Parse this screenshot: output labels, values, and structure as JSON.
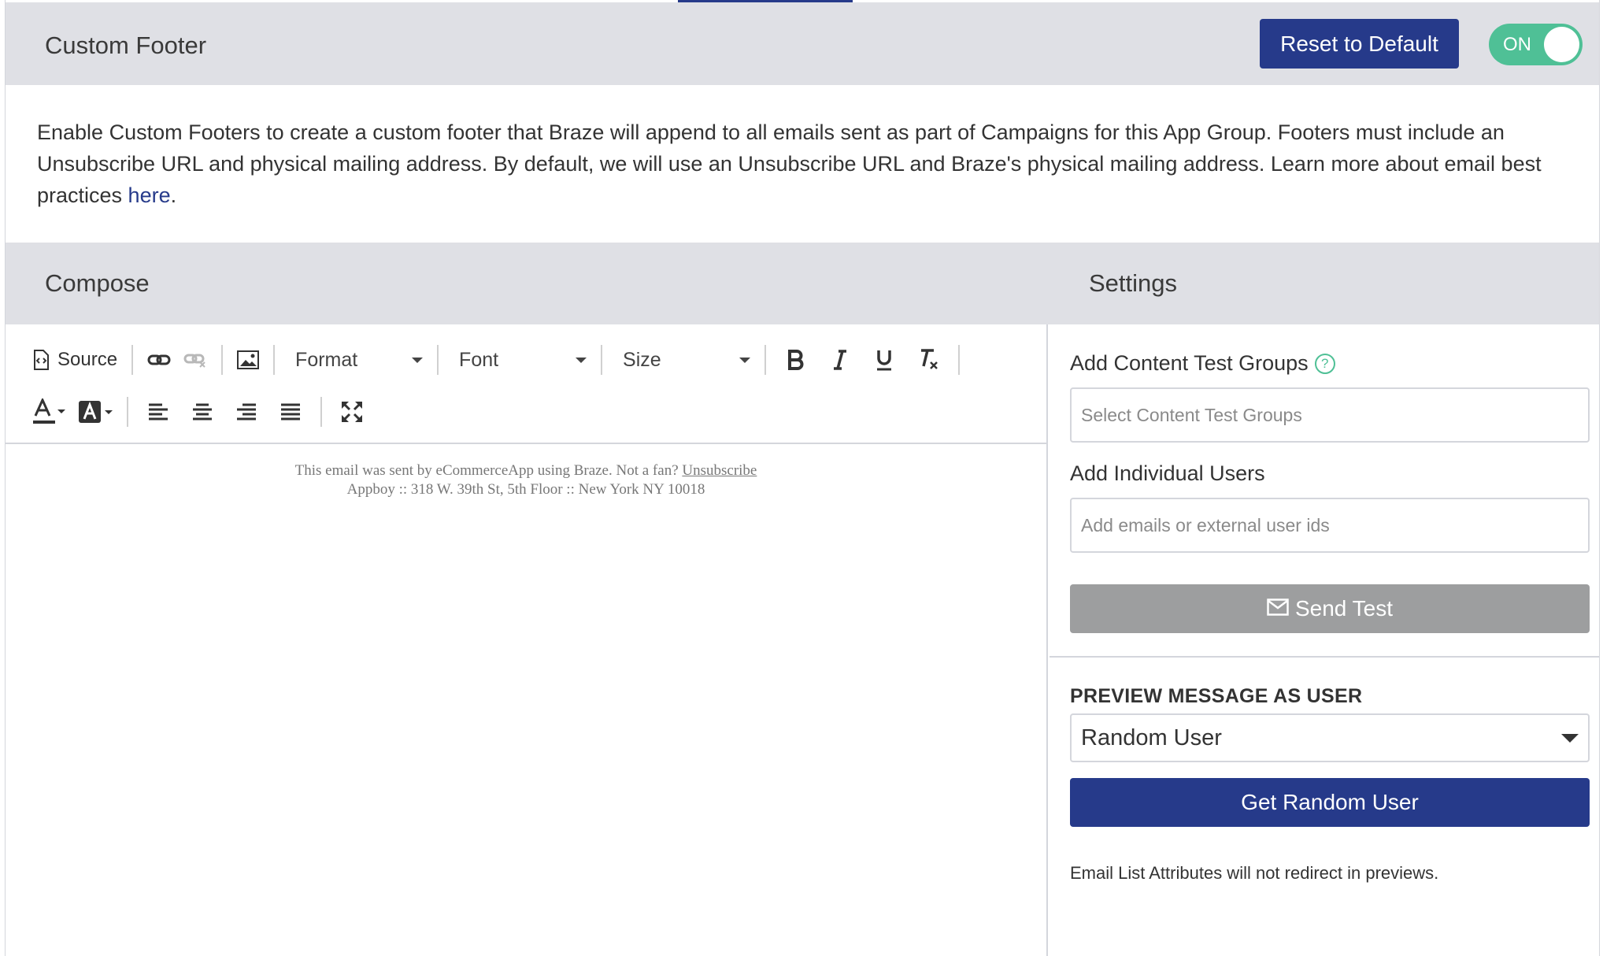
{
  "header": {
    "title": "Custom Footer",
    "reset_label": "Reset to Default",
    "toggle_label": "ON"
  },
  "description": {
    "text": "Enable Custom Footers to create a custom footer that Braze will append to all emails sent as part of Campaigns for this App Group. Footers must include an Unsubscribe URL and physical mailing address. By default, we will use an Unsubscribe URL and Braze's physical mailing address. Learn more about email best practices ",
    "link_label": "here",
    "suffix": "."
  },
  "sections": {
    "compose_title": "Compose",
    "settings_title": "Settings"
  },
  "toolbar": {
    "source_label": "Source",
    "format_label": "Format",
    "font_label": "Font",
    "size_label": "Size"
  },
  "editor": {
    "line1_prefix": "This email was sent by eCommerceApp using Braze. Not a fan? ",
    "unsubscribe_label": "Unsubscribe",
    "line2": "Appboy :: 318 W. 39th St, 5th Floor :: New York NY 10018"
  },
  "settings": {
    "content_test_groups_label": "Add Content Test Groups",
    "help_glyph": "?",
    "content_test_groups_placeholder": "Select Content Test Groups",
    "individual_users_label": "Add Individual Users",
    "individual_users_placeholder": "Add emails or external user ids",
    "send_test_label": "Send Test",
    "preview_label": "PREVIEW MESSAGE AS USER",
    "preview_selected": "Random User",
    "get_random_user_label": "Get Random User",
    "note": "Email List Attributes will not redirect in previews."
  },
  "colors": {
    "primary": "#263a8a",
    "toggle_on": "#4fc096",
    "header_bg": "#dfe0e5",
    "disabled_button": "#9d9e9f"
  }
}
